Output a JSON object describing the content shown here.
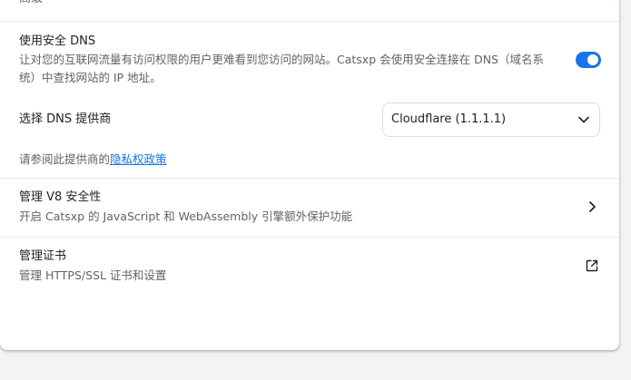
{
  "section": {
    "title": "高级"
  },
  "secure_dns": {
    "title": "使用安全 DNS",
    "description_line1": "让对您的互联网流量有访问权限的用户更难看到您访问的网站。Catsxp 会使用安全连接在 DNS（域名系",
    "description_line2": "统）中查找网站的 IP 地址。",
    "enabled": true
  },
  "dns_provider": {
    "label": "选择 DNS 提供商",
    "selected": "Cloudflare (1.1.1.1)"
  },
  "privacy": {
    "prefix": "请参阅此提供商的",
    "link_text": "隐私权政策"
  },
  "v8_security": {
    "title": "管理 V8 安全性",
    "subtitle": "开启 Catsxp 的 JavaScript 和 WebAssembly 引擎额外保护功能",
    "icon": "chevron-right-icon"
  },
  "certificates": {
    "title": "管理证书",
    "subtitle": "管理 HTTPS/SSL 证书和设置",
    "icon": "open-in-new-icon"
  },
  "colors": {
    "accent": "#1a73e8",
    "text": "#202124",
    "secondary": "#5f6368",
    "divider": "#e8eaed"
  }
}
